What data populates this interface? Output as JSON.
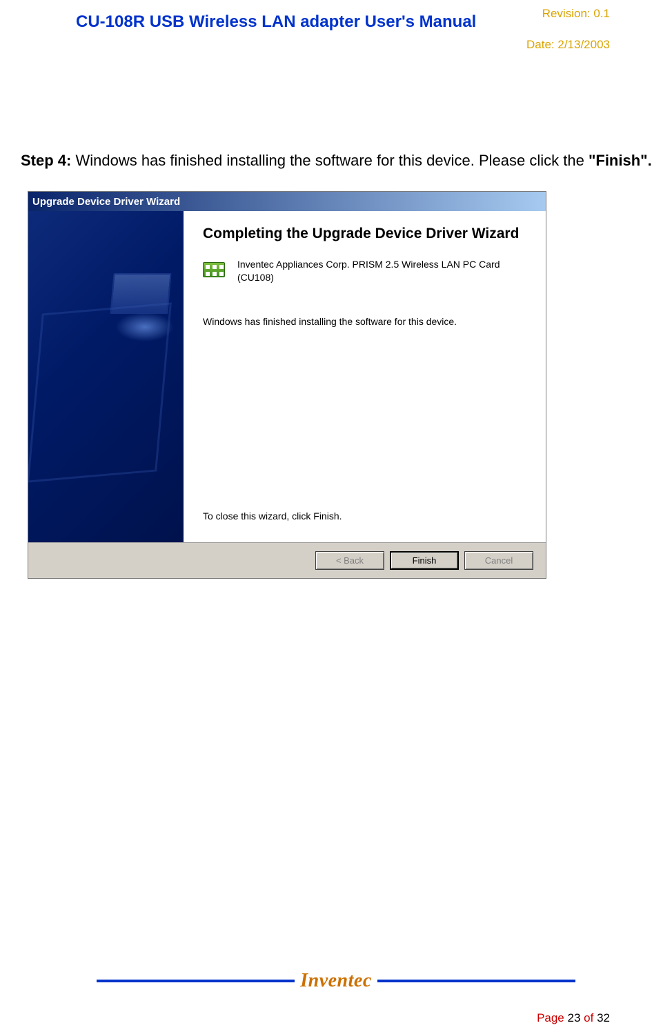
{
  "header": {
    "revision_label": "Revision:",
    "revision_value": "0.1",
    "title": "CU-108R USB Wireless LAN adapter User's Manual",
    "date_label": "Date:",
    "date_value": "2/13/2003"
  },
  "step": {
    "label": "Step 4:",
    "text": " Windows has finished installing the software for this device. Please click the ",
    "finish_quote": "\"Finish\"."
  },
  "wizard": {
    "titlebar": "Upgrade Device Driver Wizard",
    "heading": "Completing the Upgrade Device Driver Wizard",
    "device_name": "Inventec Appliances Corp. PRISM 2.5 Wireless LAN PC Card (CU108)",
    "finished_text": "Windows has finished installing the software for this device.",
    "close_text": "To close this wizard, click Finish.",
    "buttons": {
      "back": "< Back",
      "finish": "Finish",
      "cancel": "Cancel"
    }
  },
  "footer": {
    "logo": "Inventec",
    "page_label": "Page",
    "page_current": "23",
    "page_of": "of",
    "page_total": "32"
  }
}
